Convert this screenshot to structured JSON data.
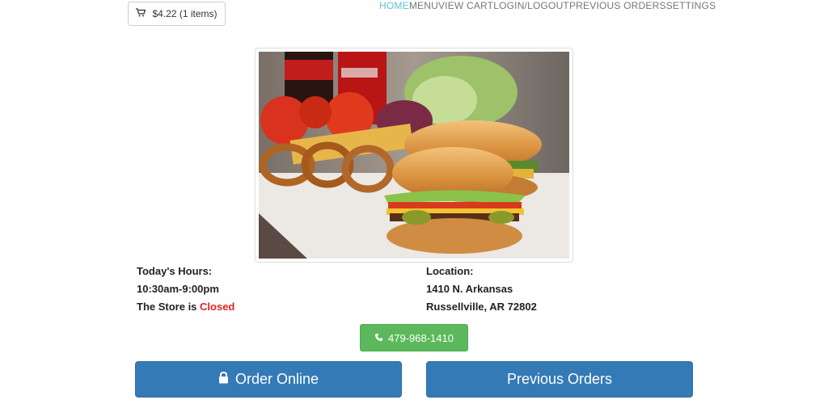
{
  "cart": {
    "label": "$4.22 (1 items)",
    "icon": "cart-icon"
  },
  "nav": {
    "items": [
      "HOME",
      "MENU",
      "VIEW CART",
      "LOGIN/LOGOUT",
      "PREVIOUS ORDERS",
      "SETTINGS"
    ],
    "active": "HOME"
  },
  "hours": {
    "heading": "Today's Hours:",
    "time": "10:30am-9:00pm",
    "status_prefix": "The Store is ",
    "status": "Closed"
  },
  "location": {
    "heading": "Location:",
    "street": "1410 N. Arkansas",
    "city": "Russellville, AR 72802"
  },
  "phone": {
    "label": "479-968-1410",
    "icon": "phone-icon",
    "color": "#5cb85c"
  },
  "actions": {
    "order_label": "Order Online",
    "order_icon": "lock-icon",
    "previous_label": "Previous Orders",
    "color": "#337ab7"
  },
  "hero": {
    "image": "burger-photo"
  }
}
